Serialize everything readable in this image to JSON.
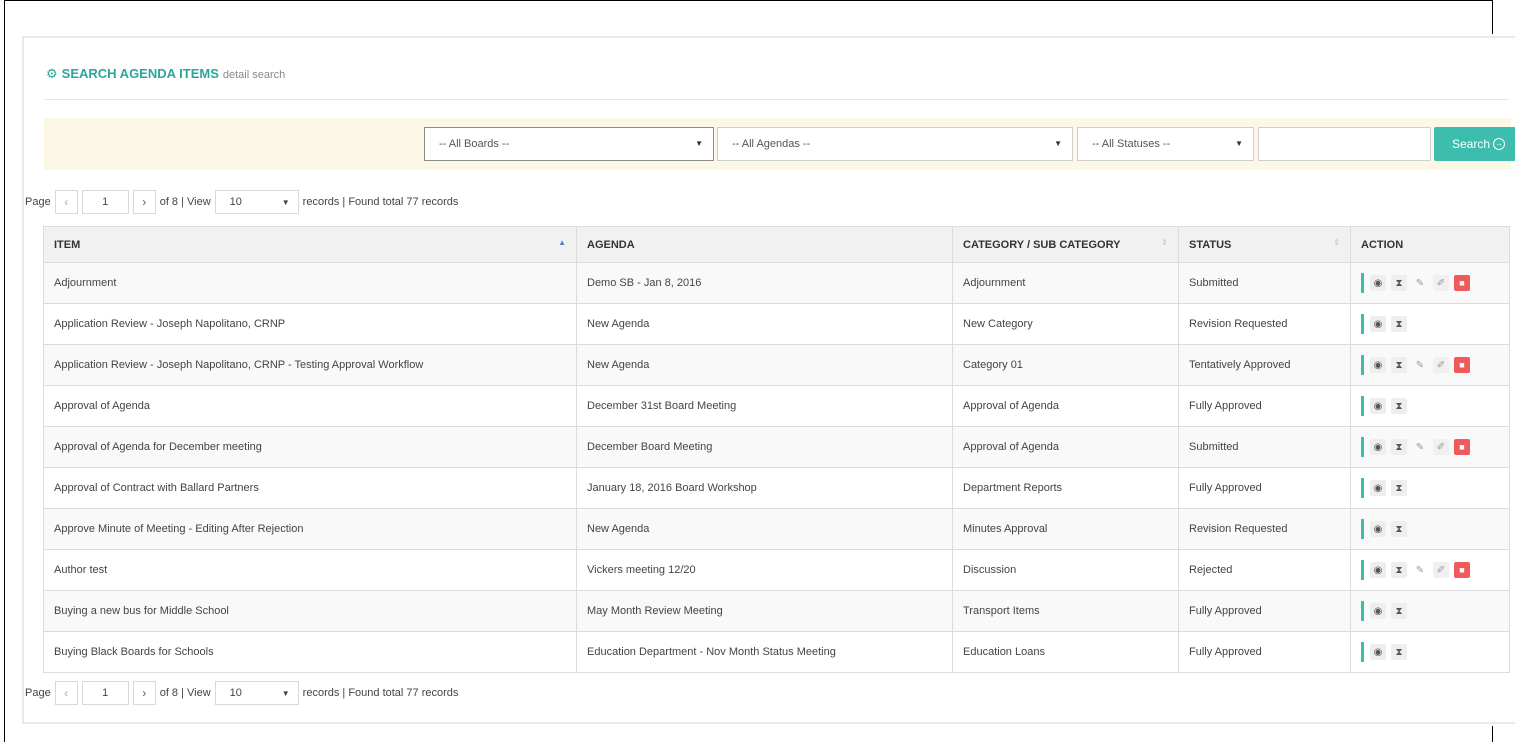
{
  "header": {
    "title": "SEARCH AGENDA ITEMS",
    "subtitle": "detail search",
    "icon": "gear-icon"
  },
  "filters": {
    "boards": "-- All Boards --",
    "agendas": "-- All Agendas --",
    "statuses": "-- All Statuses --",
    "search_value": "",
    "search_label": "Search"
  },
  "pager": {
    "page_label": "Page",
    "page_value": "1",
    "of_text": "of 8 | View",
    "view_value": "10",
    "records_text": "records | Found total 77 records"
  },
  "table": {
    "headers": {
      "item": "ITEM",
      "agenda": "AGENDA",
      "category": "CATEGORY / SUB CATEGORY",
      "status": "STATUS",
      "action": "ACTION"
    },
    "rows": [
      {
        "item": "Adjournment",
        "agenda": "Demo SB - Jan 8, 2016",
        "category": "Adjournment",
        "status": "Submitted",
        "full_actions": true
      },
      {
        "item": "Application Review - Joseph Napolitano, CRNP",
        "agenda": "New Agenda",
        "category": "New Category",
        "status": "Revision Requested",
        "full_actions": false
      },
      {
        "item": "Application Review - Joseph Napolitano, CRNP - Testing Approval Workflow",
        "agenda": "New Agenda",
        "category": "Category 01",
        "status": "Tentatively Approved",
        "full_actions": true
      },
      {
        "item": "Approval of Agenda",
        "agenda": "December 31st Board Meeting",
        "category": "Approval of Agenda",
        "status": "Fully Approved",
        "full_actions": false
      },
      {
        "item": "Approval of Agenda for December meeting",
        "agenda": "December Board Meeting",
        "category": "Approval of Agenda",
        "status": "Submitted",
        "full_actions": true
      },
      {
        "item": "Approval of Contract with Ballard Partners",
        "agenda": "January 18, 2016 Board Workshop",
        "category": "Department Reports",
        "status": "Fully Approved",
        "full_actions": false
      },
      {
        "item": "Approve Minute of Meeting - Editing After Rejection",
        "agenda": "New Agenda",
        "category": "Minutes Approval",
        "status": "Revision Requested",
        "full_actions": false
      },
      {
        "item": "Author test",
        "agenda": "Vickers meeting 12/20",
        "category": "Discussion",
        "status": "Rejected",
        "full_actions": true
      },
      {
        "item": "Buying a new bus for Middle School",
        "agenda": "May Month Review Meeting",
        "category": "Transport Items",
        "status": "Fully Approved",
        "full_actions": false
      },
      {
        "item": "Buying Black Boards for Schools",
        "agenda": "Education Department - Nov Month Status Meeting",
        "category": "Education Loans",
        "status": "Fully Approved",
        "full_actions": false
      }
    ]
  },
  "colors": {
    "accent": "#3cbdae",
    "title": "#2aa897",
    "filter_bg": "#fdf8e6",
    "delete": "#ef5a5a"
  }
}
